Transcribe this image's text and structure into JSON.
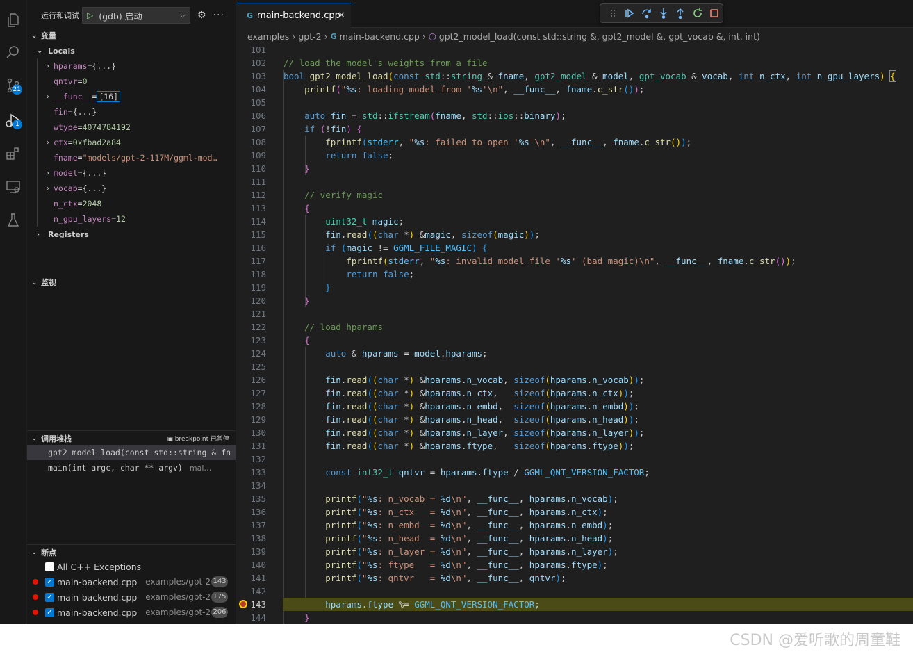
{
  "activity": {
    "scm_badge": "21",
    "debug_badge": "1"
  },
  "run": {
    "title": "运行和调试",
    "config": "(gdb) 启动"
  },
  "sections": {
    "variables": "变量",
    "locals": "Locals",
    "registers": "Registers",
    "watch": "监视",
    "callstack": "调用堆栈",
    "callstack_status": "breakpoint 已暂停",
    "breakpoints": "断点"
  },
  "locals": [
    {
      "name": "hparams",
      "value": "{...}",
      "expandable": true
    },
    {
      "name": "qntvr",
      "value": "0",
      "expandable": false
    },
    {
      "name": "__func__",
      "value": "[16]",
      "expandable": true
    },
    {
      "name": "fin",
      "value": "{...}",
      "expandable": false
    },
    {
      "name": "wtype",
      "value": "4074784192",
      "expandable": false
    },
    {
      "name": "ctx",
      "value": "0xfbad2a84",
      "expandable": true
    },
    {
      "name": "fname",
      "value": "\"models/gpt-2-117M/ggml-mod…",
      "expandable": false
    },
    {
      "name": "model",
      "value": "{...}",
      "expandable": true
    },
    {
      "name": "vocab",
      "value": "{...}",
      "expandable": true
    },
    {
      "name": "n_ctx",
      "value": "2048",
      "expandable": false
    },
    {
      "name": "n_gpu_layers",
      "value": "12",
      "expandable": false
    }
  ],
  "callstack": [
    {
      "frame": "gpt2_model_load(const std::string & fn",
      "file": ""
    },
    {
      "frame": "main(int argc, char ** argv)",
      "file": "mai…"
    }
  ],
  "breakpoints": [
    {
      "label": "All C++ Exceptions",
      "path": "",
      "line": "",
      "checked": false,
      "dot": false
    },
    {
      "label": "main-backend.cpp",
      "path": "examples/gpt-2",
      "line": "143",
      "checked": true,
      "dot": true
    },
    {
      "label": "main-backend.cpp",
      "path": "examples/gpt-2",
      "line": "175",
      "checked": true,
      "dot": true
    },
    {
      "label": "main-backend.cpp",
      "path": "examples/gpt-2",
      "line": "206",
      "checked": true,
      "dot": true
    }
  ],
  "editor": {
    "tab": "main-backend.cpp",
    "tab_icon": "G",
    "breadcrumb": [
      "examples",
      "gpt-2",
      "main-backend.cpp",
      "gpt2_model_load(const std::string &, gpt2_model &, gpt_vocab &, int, int)"
    ],
    "current_line": "143"
  },
  "code_lines": [
    "101",
    "102",
    "103",
    "104",
    "105",
    "106",
    "107",
    "108",
    "109",
    "110",
    "111",
    "112",
    "113",
    "114",
    "115",
    "116",
    "117",
    "118",
    "119",
    "120",
    "121",
    "122",
    "123",
    "124",
    "125",
    "126",
    "127",
    "128",
    "129",
    "130",
    "131",
    "132",
    "133",
    "134",
    "135",
    "136",
    "137",
    "138",
    "139",
    "140",
    "141",
    "142",
    "143",
    "144"
  ],
  "watermark": "CSDN @爱听歌的周童鞋",
  "colors": {
    "accent": "#0078d4",
    "current_line": "#4b4b18",
    "breakpoint": "#e51400"
  }
}
